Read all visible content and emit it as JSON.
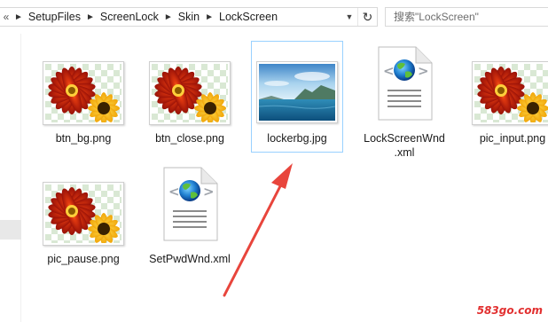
{
  "address_bar": {
    "overflow_glyph": "«",
    "crumbs": [
      "SetupFiles",
      "ScreenLock",
      "Skin",
      "LockScreen"
    ],
    "refresh_glyph": "↻"
  },
  "search": {
    "placeholder": "搜索\"LockScreen\""
  },
  "files": [
    {
      "name": "btn_bg.png",
      "type": "png-flower"
    },
    {
      "name": "btn_close.png",
      "type": "png-flower"
    },
    {
      "name": "lockerbg.jpg",
      "type": "jpg-landscape",
      "selected": true
    },
    {
      "name_line1": "LockScreenWnd",
      "name_line2": ".xml",
      "type": "xml"
    },
    {
      "name": "pic_input.png",
      "type": "png-flower"
    },
    {
      "name": "pic_pause.png",
      "type": "png-flower"
    },
    {
      "name": "SetPwdWnd.xml",
      "type": "xml"
    }
  ],
  "watermark": "583go.com",
  "colors": {
    "selection_border": "#99d1ff",
    "arrow": "#e8453c",
    "watermark": "#e23030"
  }
}
